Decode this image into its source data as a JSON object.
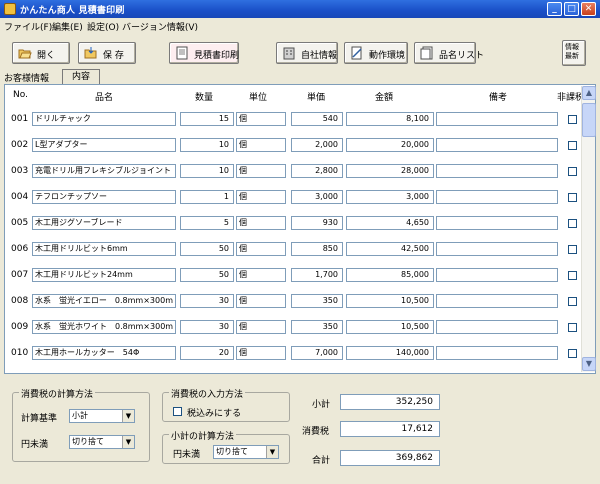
{
  "window": {
    "title": "かんたん商人 見積書印刷"
  },
  "menu": [
    "ファイル(F)",
    "編集(E)",
    "設定(O)",
    "バージョン情報(V)"
  ],
  "toolbar": {
    "open": "開く",
    "save": "保 存",
    "print": "見積書印刷",
    "company": "自社情報",
    "environment": "動作環境",
    "itemlist": "品名リスト",
    "latest": "情報\n最新"
  },
  "tabs": {
    "customer": "お客様情報",
    "content": "内容"
  },
  "columns": [
    "No.",
    "品名",
    "数量",
    "単位",
    "単価",
    "金額",
    "備考",
    "非課税"
  ],
  "rows": [
    {
      "no": "001",
      "name": "ドリルチャック",
      "qty": "15",
      "unit": "個",
      "price": "540",
      "amount": "8,100",
      "note": ""
    },
    {
      "no": "002",
      "name": "L型アダプター",
      "qty": "10",
      "unit": "個",
      "price": "2,000",
      "amount": "20,000",
      "note": ""
    },
    {
      "no": "003",
      "name": "充電ドリル用フレキシブルジョイント",
      "qty": "10",
      "unit": "個",
      "price": "2,800",
      "amount": "28,000",
      "note": ""
    },
    {
      "no": "004",
      "name": "テフロンチップソー",
      "qty": "1",
      "unit": "個",
      "price": "3,000",
      "amount": "3,000",
      "note": ""
    },
    {
      "no": "005",
      "name": "木工用ジグソーブレード",
      "qty": "5",
      "unit": "個",
      "price": "930",
      "amount": "4,650",
      "note": ""
    },
    {
      "no": "006",
      "name": "木工用ドリルビット6mm",
      "qty": "50",
      "unit": "個",
      "price": "850",
      "amount": "42,500",
      "note": ""
    },
    {
      "no": "007",
      "name": "木工用ドリルビット24mm",
      "qty": "50",
      "unit": "個",
      "price": "1,700",
      "amount": "85,000",
      "note": ""
    },
    {
      "no": "008",
      "name": "水系　蛍光イエロー　0.8mm×300m",
      "qty": "30",
      "unit": "個",
      "price": "350",
      "amount": "10,500",
      "note": ""
    },
    {
      "no": "009",
      "name": "水系　蛍光ホワイト　0.8mm×300m",
      "qty": "30",
      "unit": "個",
      "price": "350",
      "amount": "10,500",
      "note": ""
    },
    {
      "no": "010",
      "name": "木工用ホールカッター　54Φ",
      "qty": "20",
      "unit": "個",
      "price": "7,000",
      "amount": "140,000",
      "note": ""
    }
  ],
  "tax_calc": {
    "title": "消費税の計算方法",
    "basis_label": "計算基準",
    "basis_value": "小計",
    "rounding_label": "円未満",
    "rounding_value": "切り捨て"
  },
  "tax_input": {
    "title": "消費税の入力方法",
    "checkbox_label": "税込みにする"
  },
  "subtotal_calc": {
    "title": "小計の計算方法",
    "rounding_label": "円未満",
    "rounding_value": "切り捨て"
  },
  "totals": {
    "subtotal_label": "小計",
    "subtotal": "352,250",
    "tax_label": "消費税",
    "tax": "17,612",
    "total_label": "合計",
    "total": "369,862"
  }
}
